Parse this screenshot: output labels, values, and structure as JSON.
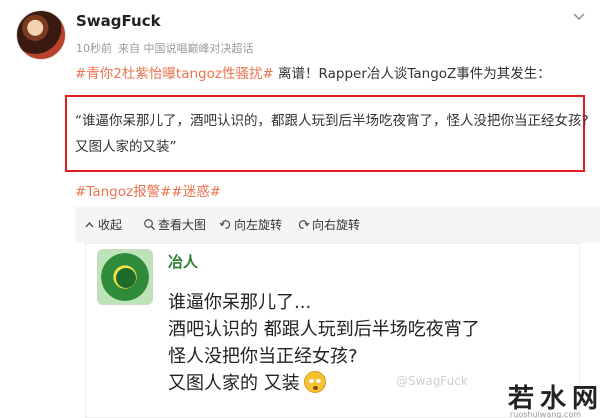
{
  "post": {
    "username": "SwagFuck",
    "time": "10秒前",
    "source": "来自 中国说唱巅峰对决超话",
    "text": {
      "hashtag1": "#青你2杜紫怡曝tangoz性骚扰#",
      "body": " 离谱！Rapper冶人谈TangoZ事件为其发生："
    },
    "quote": {
      "line1": "“谁逼你呆那儿了，酒吧认识的，都跟人玩到后半场吃夜宵了，怪人没把你当正经女孩?",
      "line2": "又图人家的又装”"
    },
    "tags": [
      "#Tangoz报警#",
      "#迷惑#"
    ]
  },
  "toolbar": {
    "collapse": "收起",
    "view_large": "查看大图",
    "rotate_left": "向左旋转",
    "rotate_right": "向右旋转"
  },
  "screenshot": {
    "name": "冶人",
    "lines": [
      "谁逼你呆那儿了...",
      "酒吧认识的 都跟人玩到后半场吃夜宵了",
      "怪人没把你当正经女孩?",
      "又图人家的 又装"
    ],
    "watermark": "@SwagFuck"
  },
  "site_watermark": {
    "main": "若水网",
    "sub": "ruoshuiwang.com"
  },
  "colors": {
    "tag": "#eb7350",
    "highlight_border": "#e02020",
    "name_green": "#2e7d32"
  }
}
